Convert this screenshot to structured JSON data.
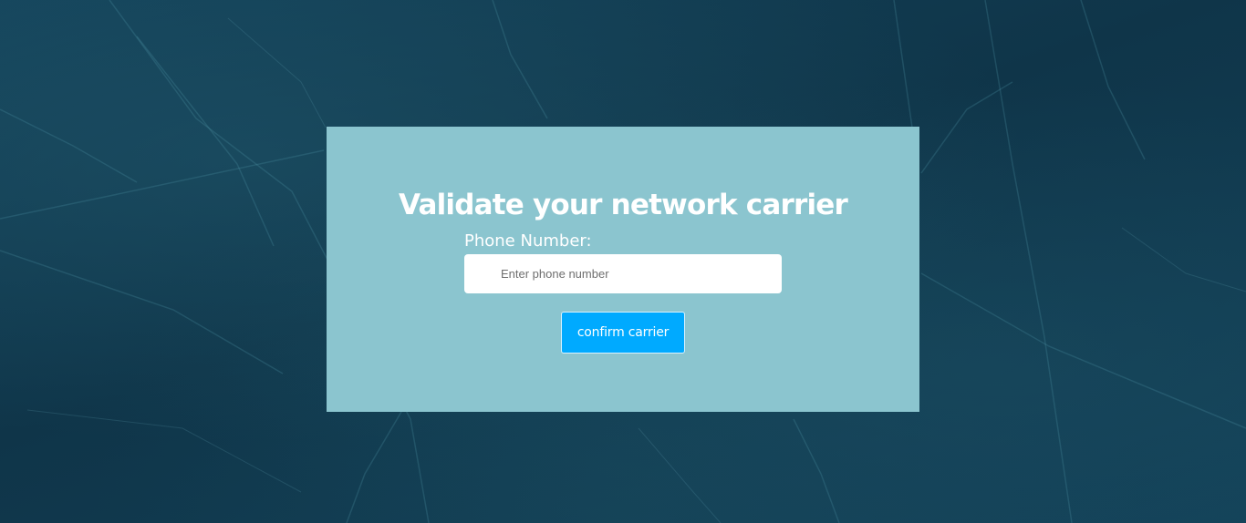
{
  "form": {
    "title": "Validate your network carrier",
    "phone_label": "Phone Number:",
    "phone_placeholder": "Enter phone number",
    "phone_value": "",
    "submit_label": "confirm carrier"
  },
  "colors": {
    "background": "#123b4f",
    "card": "#8bc5cf",
    "button": "#00aaff",
    "text": "#ffffff"
  }
}
